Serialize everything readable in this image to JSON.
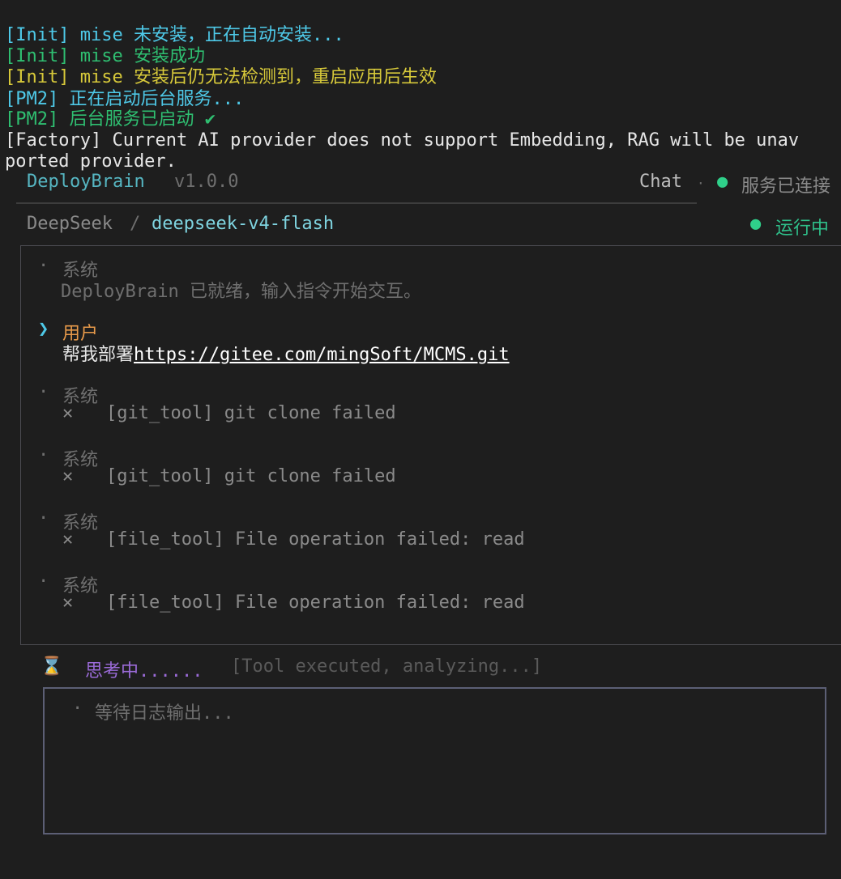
{
  "terminal_log": [
    {
      "prefix": "[Init]",
      "tool": "mise",
      "message": "未安装，正在自动安装...",
      "color": "cyan"
    },
    {
      "prefix": "[Init]",
      "tool": "mise",
      "message": "安装成功",
      "color": "green"
    },
    {
      "prefix": "[Init]",
      "tool": "mise",
      "message": "安装后仍无法检测到，重启应用后生效",
      "color": "yellow"
    },
    {
      "prefix": "[PM2]",
      "message": "正在启动后台服务...",
      "color": "cyan"
    },
    {
      "prefix": "[PM2]",
      "message": "后台服务已启动 ✔",
      "color": "green"
    },
    {
      "prefix": "[Factory]",
      "message": "Current AI provider does not support Embedding, RAG will be unav",
      "color": "white"
    },
    {
      "message": "ported provider.",
      "color": "white"
    }
  ],
  "header": {
    "app_name": "DeployBrain",
    "version": "v1.0.0",
    "mode": "Chat",
    "separator": "·",
    "status_dot": "●",
    "status": "服务已连接"
  },
  "model_bar": {
    "provider": "DeepSeek",
    "separator": "/",
    "model": "deepseek-v4-flash",
    "status_dot": "●",
    "status": "运行中"
  },
  "messages": [
    {
      "role": "系统",
      "marker": "·",
      "text": "DeployBrain 已就绪，输入指令开始交互。"
    },
    {
      "role": "用户",
      "marker": "❯",
      "text_prefix": "帮我部署",
      "link": "https://gitee.com/mingSoft/MCMS.git"
    },
    {
      "role": "系统",
      "marker": "·",
      "icon": "✕",
      "text": "[git_tool] git clone failed"
    },
    {
      "role": "系统",
      "marker": "·",
      "icon": "✕",
      "text": "[git_tool] git clone failed"
    },
    {
      "role": "系统",
      "marker": "·",
      "icon": "✕",
      "text": "[file_tool] File operation failed: read"
    },
    {
      "role": "系统",
      "marker": "·",
      "icon": "✕",
      "text": "[file_tool] File operation failed: read"
    }
  ],
  "thinking": {
    "icon": "⌛",
    "label": "思考中......",
    "detail": "[Tool executed, analyzing...]"
  },
  "log_panel": {
    "marker": "·",
    "placeholder": "等待日志输出..."
  },
  "colors": {
    "background": "#1e1e1e",
    "accent_cyan": "#4ec9e8",
    "success_green": "#2fbf71",
    "warning_yellow": "#d7c93a",
    "user_orange": "#e89a4a",
    "thinking_purple": "#9b6bd8"
  }
}
